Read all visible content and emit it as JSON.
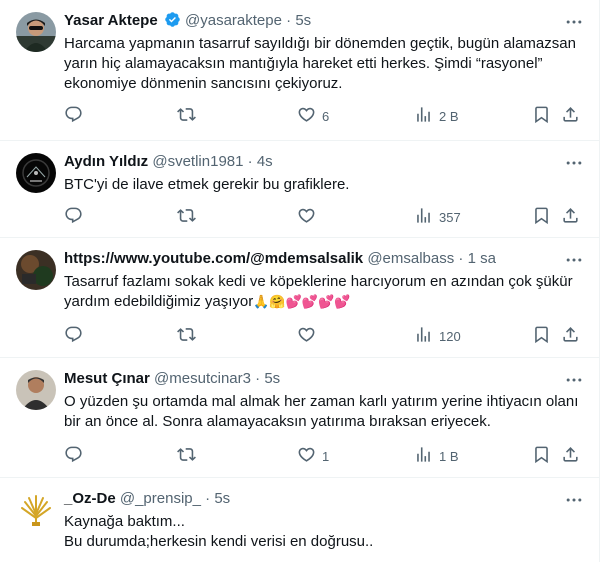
{
  "tweets": [
    {
      "name": "Yasar Aktepe",
      "handle": "@yasaraktepe",
      "sep": "·",
      "time": "5s",
      "verified": true,
      "text": "Harcama yapmanın tasarruf sayıldığı bir dönemden geçtik, bugün alamazsan yarın hiç alamayacaksın mantığıyla hareket etti herkes. Şimdi “rasyonel”  ekonomiye dönmenin sancısını çekiyoruz.",
      "reply_count": "",
      "retweet_count": "",
      "like_count": "6",
      "view_count": "2 B"
    },
    {
      "name": "Aydın Yıldız",
      "handle": "@svetlin1981",
      "sep": "·",
      "time": "4s",
      "text": "BTC'yi de ilave etmek gerekir bu grafiklere.",
      "reply_count": "",
      "retweet_count": "",
      "like_count": "",
      "view_count": "357"
    },
    {
      "name": "https://www.youtube.com/@mdemsalsalik",
      "handle": "@emsalbass",
      "sep": "·",
      "time": "1 sa",
      "text": "Tasarruf fazlamı sokak kedi ve köpeklerine harcıyorum en azından çok şükür yardım edebildiğimiz yaşıyor",
      "emojis": "🙏🤗💕💕💕💕",
      "reply_count": "",
      "retweet_count": "",
      "like_count": "",
      "view_count": "120"
    },
    {
      "name": "Mesut Çınar",
      "handle": "@mesutcinar3",
      "sep": "·",
      "time": "5s",
      "text": "O yüzden şu ortamda mal almak her zaman karlı yatırım yerine ihtiyacın olanı bir an önce al. Sonra alamayacaksın yatırıma bıraksan eriyecek.",
      "reply_count": "",
      "retweet_count": "",
      "like_count": "1",
      "view_count": "1 B"
    },
    {
      "name": "_Oz-De",
      "handle": "@_prensip_",
      "sep": "·",
      "time": "5s",
      "text": "Kaynağa baktım...\nBu durumda;herkesin kendi verisi en doğrusu.."
    }
  ],
  "colors": {
    "text": "#0f1419",
    "secondary": "#536471",
    "verified": "#1d9bf0",
    "divider": "#eff3f4"
  },
  "icons": [
    "reply-icon",
    "retweet-icon",
    "like-icon",
    "views-icon",
    "bookmark-icon",
    "share-icon",
    "more-icon",
    "verified-badge-icon"
  ]
}
